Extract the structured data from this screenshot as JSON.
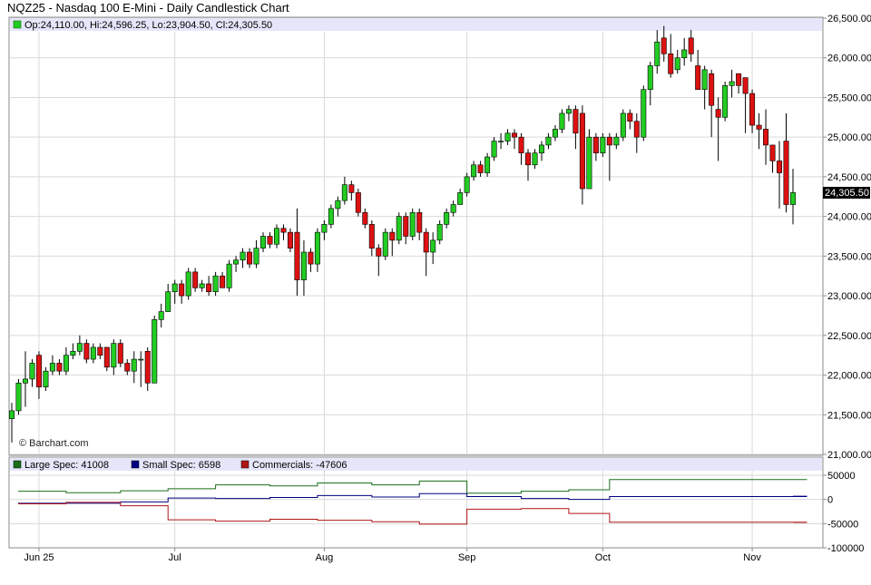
{
  "title": "NQZ25 - Nasdaq 100 E-Mini - Daily Candlestick Chart",
  "ohlc_label": "Op:24,110.00, Hi:24,596.25, Lo:23,904.50, Cl:24,305.50",
  "last_price_label": "24,305.50",
  "watermark": "© Barchart.com",
  "colors": {
    "up": "#22cc22",
    "down": "#dd1111",
    "large_spec": "#1a6e1a",
    "small_spec": "#000080",
    "commercials": "#b01515",
    "legend_band": "#e6e6fa",
    "grid": "#d9d9d9"
  },
  "cot_legend": [
    {
      "label": "Large Spec: 41008",
      "color": "#1a6e1a"
    },
    {
      "label": "Small Spec: 6598",
      "color": "#000080"
    },
    {
      "label": "Commercials: -47606",
      "color": "#b01515"
    }
  ],
  "chart_data": [
    {
      "type": "candlestick",
      "title": "NQZ25 - Nasdaq 100 E-Mini - Daily Candlestick Chart",
      "ylim": [
        21000,
        26500
      ],
      "y_ticks": [
        "26,500.00",
        "26,000.00",
        "25,500.00",
        "25,000.00",
        "24,500.00",
        "24,000.00",
        "23,500.00",
        "23,000.00",
        "22,500.00",
        "22,000.00",
        "21,500.00",
        "21,000.00"
      ],
      "y_tick_values": [
        26500,
        26000,
        25500,
        25000,
        24500,
        24000,
        23500,
        23000,
        22500,
        22000,
        21500,
        21000
      ],
      "x_ticks": [
        {
          "label": "Jun 25",
          "index": 4
        },
        {
          "label": "Jul",
          "index": 24
        },
        {
          "label": "Aug",
          "index": 46
        },
        {
          "label": "Sep",
          "index": 67
        },
        {
          "label": "Oct",
          "index": 87
        },
        {
          "label": "Nov",
          "index": 109
        }
      ],
      "closes": [
        21550,
        21900,
        21950,
        22150,
        21850,
        22050,
        22150,
        22050,
        22250,
        22300,
        22400,
        22200,
        22350,
        22250,
        22100,
        22400,
        22150,
        22050,
        22200,
        22200,
        21900,
        22700,
        22800,
        23050,
        23150,
        23000,
        23300,
        23100,
        23150,
        23050,
        23250,
        23100,
        23400,
        23450,
        23550,
        23400,
        23600,
        23750,
        23650,
        23850,
        23800,
        23600,
        23200,
        23550,
        23400,
        23800,
        23900,
        24100,
        24200,
        24400,
        24300,
        24050,
        23900,
        23600,
        23500,
        23800,
        23700,
        24000,
        23750,
        24050,
        23800,
        23550,
        23700,
        23900,
        24050,
        24150,
        24300,
        24500,
        24650,
        24550,
        24750,
        24950,
        24950,
        25050,
        25000,
        24800,
        24650,
        24800,
        24900,
        25000,
        25100,
        25300,
        25350,
        25050,
        24350,
        25000,
        24800,
        25000,
        24900,
        25000,
        25300,
        25200,
        25000,
        25600,
        25900,
        26200,
        26050,
        25800,
        26000,
        26100,
        26050,
        25600,
        25850,
        25400,
        25250,
        25650,
        25700,
        25650,
        25550,
        25150,
        25100,
        24900,
        24700,
        24550,
        24150,
        24300
      ],
      "opens": [
        21450,
        21550,
        21900,
        21950,
        22250,
        21850,
        22050,
        22150,
        22050,
        22250,
        22300,
        22400,
        22200,
        22350,
        22350,
        22100,
        22400,
        22150,
        22050,
        22200,
        22300,
        21900,
        22700,
        22800,
        23050,
        23150,
        23000,
        23300,
        23100,
        23150,
        23050,
        23250,
        23100,
        23400,
        23450,
        23550,
        23400,
        23600,
        23750,
        23650,
        23850,
        23800,
        23800,
        23200,
        23550,
        23400,
        23800,
        23900,
        24100,
        24200,
        24400,
        24300,
        24050,
        23900,
        23600,
        23500,
        23800,
        23700,
        24000,
        23750,
        24050,
        23800,
        23550,
        23700,
        23900,
        24050,
        24150,
        24300,
        24500,
        24650,
        24550,
        24750,
        24950,
        24950,
        25050,
        25000,
        24800,
        24650,
        24800,
        24900,
        25000,
        25100,
        25300,
        25350,
        25300,
        24350,
        25000,
        24800,
        25000,
        24900,
        25000,
        25300,
        25200,
        25000,
        25600,
        25900,
        26250,
        26050,
        25850,
        26000,
        26250,
        25900,
        25600,
        25800,
        25350,
        25250,
        25650,
        25800,
        25750,
        25550,
        25150,
        25100,
        24900,
        24700,
        24950,
        24150
      ],
      "highs": [
        21650,
        21950,
        22300,
        22200,
        22300,
        22100,
        22250,
        22200,
        22350,
        22400,
        22500,
        22450,
        22400,
        22400,
        22350,
        22450,
        22450,
        22200,
        22300,
        22300,
        22350,
        22750,
        22900,
        23150,
        23200,
        23200,
        23350,
        23350,
        23200,
        23250,
        23300,
        23300,
        23450,
        23500,
        23600,
        23600,
        23700,
        23800,
        23800,
        23900,
        23900,
        23850,
        24100,
        23700,
        23600,
        23850,
        23950,
        24150,
        24250,
        24500,
        24450,
        24350,
        24100,
        23950,
        23650,
        23850,
        23850,
        24050,
        24050,
        24100,
        24100,
        23850,
        23800,
        23950,
        24100,
        24200,
        24350,
        24550,
        24700,
        24700,
        24800,
        25000,
        25050,
        25100,
        25100,
        25050,
        24850,
        24850,
        24950,
        25050,
        25150,
        25350,
        25400,
        25400,
        25400,
        25100,
        25050,
        25050,
        25050,
        25050,
        25350,
        25350,
        25300,
        25650,
        25950,
        26350,
        26400,
        26300,
        26100,
        26250,
        26350,
        26100,
        25900,
        25850,
        25500,
        25700,
        25850,
        25800,
        25750,
        25600,
        25300,
        25350,
        24900,
        24950,
        25300,
        24600
      ],
      "lows": [
        21150,
        21500,
        21600,
        21850,
        21700,
        21800,
        22000,
        22000,
        22000,
        22200,
        22250,
        22150,
        22150,
        22200,
        22050,
        22000,
        22100,
        22000,
        21900,
        21850,
        21800,
        21900,
        22600,
        22800,
        22900,
        22900,
        22950,
        23050,
        23050,
        23000,
        23000,
        23100,
        23050,
        23300,
        23350,
        23350,
        23350,
        23550,
        23600,
        23600,
        23700,
        23550,
        23000,
        23000,
        23300,
        23300,
        23700,
        23850,
        24000,
        24150,
        24200,
        24000,
        23850,
        23500,
        23250,
        23450,
        23500,
        23650,
        23650,
        23700,
        23700,
        23250,
        23400,
        23650,
        23850,
        24000,
        24150,
        24250,
        24450,
        24500,
        24500,
        24700,
        24850,
        24900,
        24850,
        24650,
        24450,
        24600,
        24700,
        24850,
        24950,
        25050,
        25200,
        24850,
        24150,
        24350,
        24700,
        24750,
        24450,
        24850,
        24950,
        25100,
        24800,
        24950,
        25400,
        25800,
        25950,
        25750,
        25800,
        25900,
        25950,
        25600,
        25350,
        25000,
        24700,
        25200,
        25500,
        25550,
        25050,
        25050,
        24850,
        24650,
        24550,
        24100,
        24050,
        23900
      ]
    },
    {
      "type": "line",
      "title": "COT positions",
      "ylim": [
        -100000,
        50000
      ],
      "y_ticks": [
        "50000",
        "0",
        "-50000",
        "-100000"
      ],
      "y_tick_values": [
        50000,
        0,
        -50000,
        -100000
      ],
      "step_dates_index": [
        0,
        8,
        16,
        23,
        30,
        38,
        45,
        53,
        60,
        67,
        75,
        82,
        88,
        96,
        103,
        110,
        117
      ],
      "series": [
        {
          "name": "Large Spec: 41008",
          "values": [
            17000,
            14000,
            18000,
            22000,
            30000,
            28000,
            34000,
            30000,
            38000,
            13000,
            17000,
            20000,
            41000,
            41000,
            41000,
            41000,
            41008
          ]
        },
        {
          "name": "Small Spec: 6598",
          "values": [
            -8000,
            -8000,
            -5000,
            3000,
            2000,
            4000,
            8000,
            5000,
            12000,
            6000,
            2000,
            0,
            6000,
            6000,
            6000,
            6000,
            6598
          ]
        },
        {
          "name": "Commercials: -47606",
          "values": [
            -9000,
            -6000,
            -13000,
            -42000,
            -45000,
            -41000,
            -43000,
            -46000,
            -51000,
            -20000,
            -19000,
            -29000,
            -47000,
            -47000,
            -47000,
            -47000,
            -47606
          ]
        }
      ]
    }
  ]
}
